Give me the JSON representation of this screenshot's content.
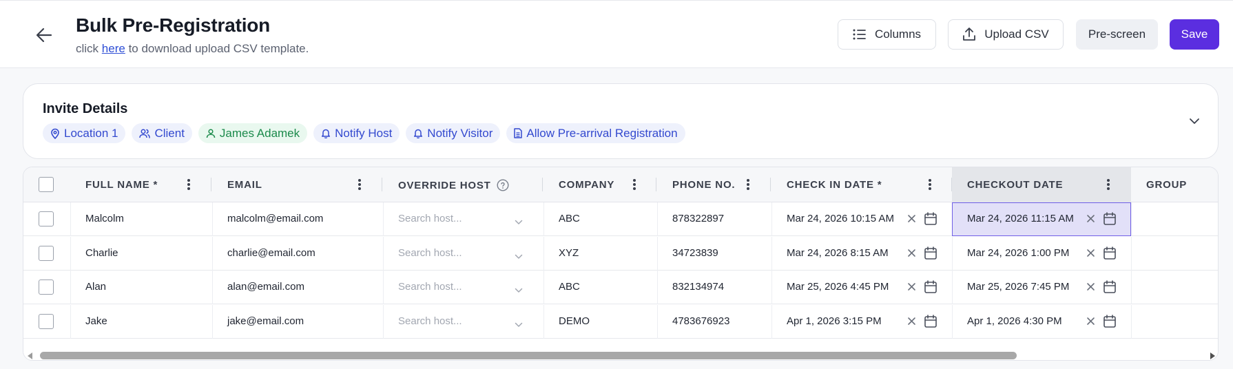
{
  "header": {
    "title": "Bulk Pre-Registration",
    "subtitle_prefix": "click",
    "subtitle_link": "here",
    "subtitle_suffix": "to download upload CSV template.",
    "buttons": {
      "columns": "Columns",
      "upload_csv": "Upload CSV",
      "prescreen": "Pre-screen",
      "save": "Save"
    }
  },
  "invite": {
    "title": "Invite Details",
    "chips": [
      {
        "label": "Location 1",
        "icon": "map-pin-icon"
      },
      {
        "label": "Client",
        "icon": "users-icon"
      },
      {
        "label": "James Adamek",
        "icon": "user-icon"
      },
      {
        "label": "Notify Host",
        "icon": "bell-icon"
      },
      {
        "label": "Notify Visitor",
        "icon": "bell-icon"
      },
      {
        "label": "Allow Pre-arrival Registration",
        "icon": "document-icon"
      }
    ]
  },
  "table": {
    "columns": [
      "FULL NAME *",
      "EMAIL",
      "OVERRIDE HOST",
      "COMPANY",
      "PHONE NO.",
      "CHECK IN DATE *",
      "CHECKOUT DATE",
      "GROUP"
    ],
    "host_placeholder": "Search host...",
    "rows": [
      {
        "name": "Malcolm",
        "email": "malcolm@email.com",
        "company": "ABC",
        "phone": "878322897",
        "checkin": "Mar 24, 2026 10:15 AM",
        "checkout": "Mar 24, 2026 11:15 AM"
      },
      {
        "name": "Charlie",
        "email": "charlie@email.com",
        "company": "XYZ",
        "phone": "34723839",
        "checkin": "Mar 24, 2026 8:15 AM",
        "checkout": "Mar 24, 2026 1:00 PM"
      },
      {
        "name": "Alan",
        "email": "alan@email.com",
        "company": "ABC",
        "phone": "832134974",
        "checkin": "Mar 25, 2026 4:45 PM",
        "checkout": "Mar 25, 2026 7:45 PM"
      },
      {
        "name": "Jake",
        "email": "jake@email.com",
        "company": "DEMO",
        "phone": "4783676923",
        "checkin": "Apr 1, 2026 3:15 PM",
        "checkout": "Apr 1, 2026 4:30 PM"
      }
    ]
  },
  "colors": {
    "primary": "#5b2ee0",
    "chip_blue_bg": "#eef1fc",
    "chip_blue_text": "#3349cf",
    "chip_green_bg": "#e9f8ef",
    "chip_green_text": "#1b8a4b",
    "selected_cell": "#e2e0f8"
  }
}
